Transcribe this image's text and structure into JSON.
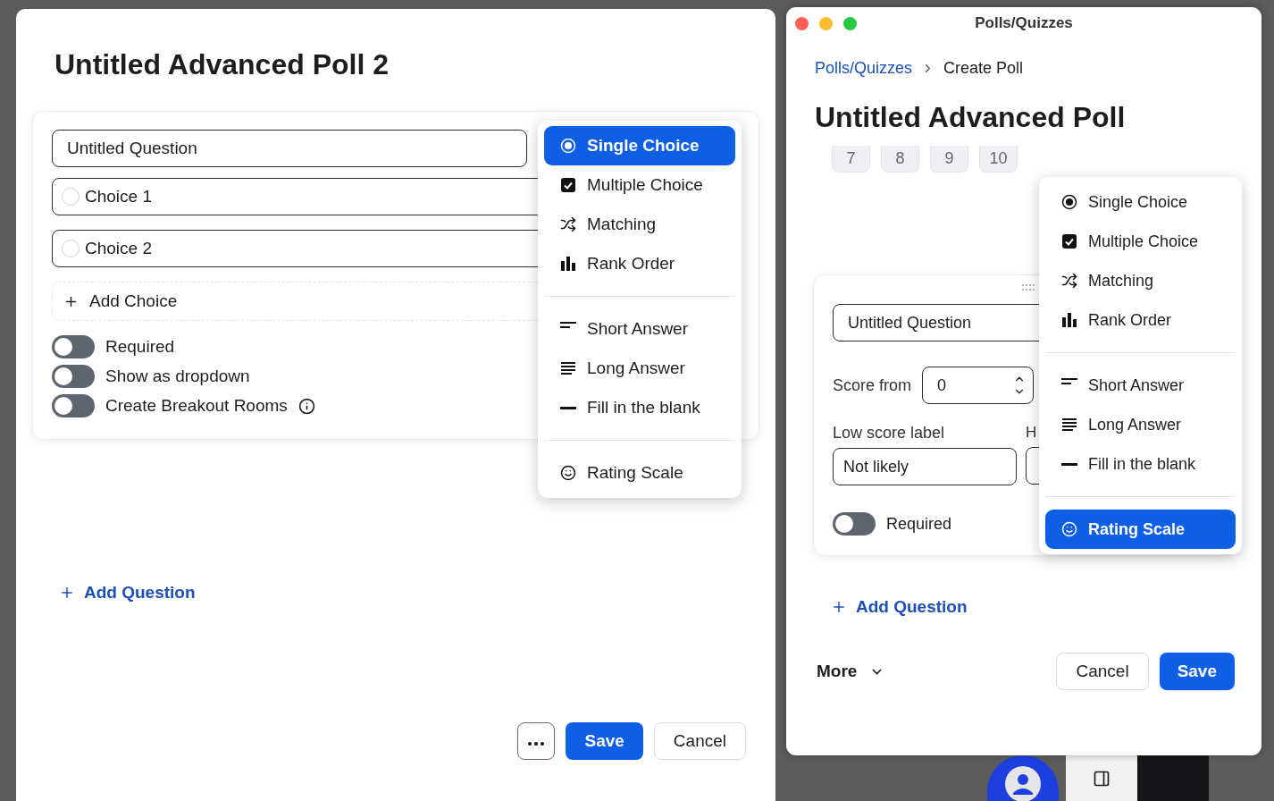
{
  "left_panel": {
    "title": "Untitled Advanced Poll 2",
    "question": {
      "value": "Untitled Question"
    },
    "choices": [
      {
        "value": "Choice 1"
      },
      {
        "value": "Choice 2"
      }
    ],
    "add_choice": "Add Choice",
    "toggles": [
      {
        "label": "Required",
        "on": false,
        "info": false
      },
      {
        "label": "Show as dropdown",
        "on": false,
        "info": false
      },
      {
        "label": "Create Breakout Rooms",
        "on": false,
        "info": true
      }
    ],
    "type_menu": {
      "sections": [
        {
          "items": [
            {
              "kind": "radio",
              "label": "Single Choice",
              "selected": true
            },
            {
              "kind": "checkbox",
              "label": "Multiple Choice",
              "selected": false
            },
            {
              "kind": "shuffle",
              "label": "Matching",
              "selected": false
            },
            {
              "kind": "bars",
              "label": "Rank Order",
              "selected": false
            }
          ]
        },
        {
          "items": [
            {
              "kind": "short",
              "label": "Short Answer",
              "selected": false
            },
            {
              "kind": "long",
              "label": "Long Answer",
              "selected": false
            },
            {
              "kind": "blank",
              "label": "Fill in the blank",
              "selected": false
            }
          ]
        },
        {
          "items": [
            {
              "kind": "smile",
              "label": "Rating Scale",
              "selected": false
            }
          ]
        }
      ]
    },
    "add_question": "Add Question",
    "buttons": [
      {
        "kind": "more"
      },
      {
        "kind": "primary",
        "label": "Save"
      },
      {
        "kind": "secondary",
        "label": "Cancel"
      }
    ]
  },
  "right_window": {
    "title": "Polls/Quizzes",
    "breadcrumb": [
      {
        "label": "Polls/Quizzes",
        "current": false
      },
      {
        "label": "Create Poll",
        "current": true
      }
    ],
    "heading": "Untitled Advanced Poll",
    "scale_chips": [
      "7",
      "8",
      "9",
      "10"
    ],
    "question": {
      "value": "Untitled Question"
    },
    "score_from": {
      "label": "Score from",
      "value": "0"
    },
    "low_score": {
      "label": "Low score label",
      "value": "Not likely"
    },
    "high_score": {
      "label": "H"
    },
    "toggle": {
      "label": "Required",
      "on": false
    },
    "type_menu": {
      "sections": [
        {
          "items": [
            {
              "kind": "radio",
              "label": "Single Choice",
              "selected": false
            },
            {
              "kind": "checkbox",
              "label": "Multiple Choice",
              "selected": false
            },
            {
              "kind": "shuffle",
              "label": "Matching",
              "selected": false
            },
            {
              "kind": "bars",
              "label": "Rank Order",
              "selected": false
            }
          ]
        },
        {
          "items": [
            {
              "kind": "short",
              "label": "Short Answer",
              "selected": false
            },
            {
              "kind": "long",
              "label": "Long Answer",
              "selected": false
            },
            {
              "kind": "blank",
              "label": "Fill in the blank",
              "selected": false
            }
          ]
        },
        {
          "items": [
            {
              "kind": "smile",
              "label": "Rating Scale",
              "selected": true
            }
          ]
        }
      ]
    },
    "add_question": "Add Question",
    "more": "More",
    "buttons": [
      {
        "kind": "secondary",
        "label": "Cancel"
      },
      {
        "kind": "primary",
        "label": "Save"
      }
    ]
  }
}
